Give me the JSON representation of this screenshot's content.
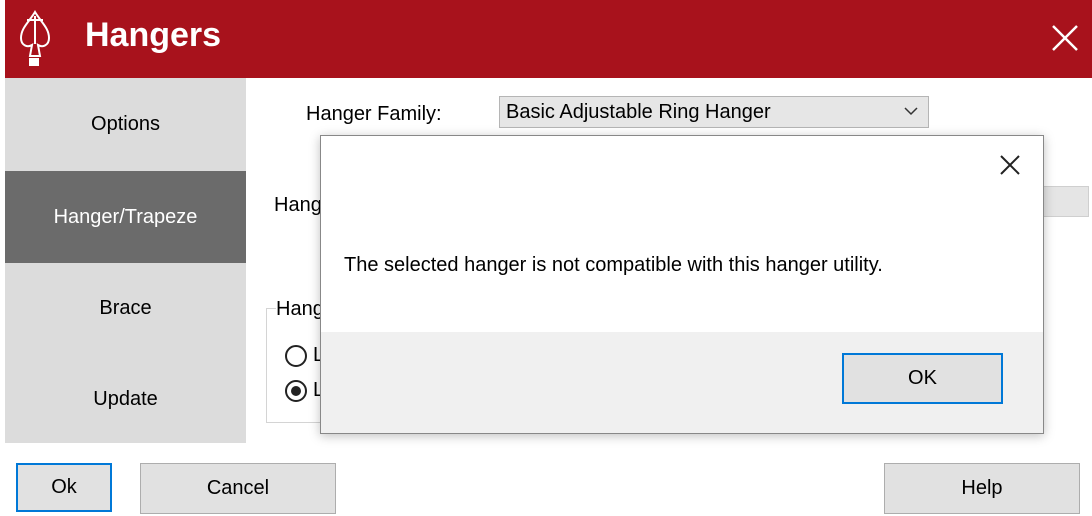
{
  "window": {
    "title": "Hangers",
    "logo_icon": "spade-logo-icon",
    "accent_color": "#a8121c"
  },
  "nav": {
    "items": [
      {
        "label": "Options",
        "active": false
      },
      {
        "label": "Hanger/Trapeze",
        "active": true
      },
      {
        "label": "Brace",
        "active": false
      },
      {
        "label": "Update",
        "active": false
      }
    ]
  },
  "form": {
    "hanger_family_label": "Hanger Family:",
    "hanger_family_value": "Basic Adjustable Ring Hanger",
    "partial_label_1": "Hang",
    "group_label": "Hang",
    "radio_1_label": "L",
    "radio_2_label": "L"
  },
  "buttons": {
    "ok": "Ok",
    "cancel": "Cancel",
    "help": "Help"
  },
  "dialog": {
    "message": "The selected hanger is not compatible with this hanger utility.",
    "ok_label": "OK"
  }
}
